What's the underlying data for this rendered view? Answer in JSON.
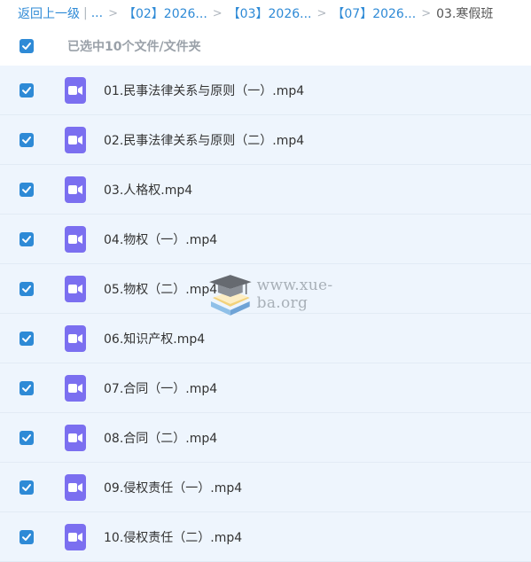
{
  "breadcrumb": {
    "back_label": "返回上一级",
    "pipe": "|",
    "ellipsis": "...",
    "separator": ">",
    "items": [
      "【02】2026...",
      "【03】2026...",
      "【07】2026..."
    ],
    "current": "03.寒假班"
  },
  "select_all": {
    "label": "已选中10个文件/文件夹",
    "checked": true
  },
  "files": [
    {
      "name": "01.民事法律关系与原则（一）.mp4",
      "checked": true
    },
    {
      "name": "02.民事法律关系与原则（二）.mp4",
      "checked": true
    },
    {
      "name": "03.人格权.mp4",
      "checked": true
    },
    {
      "name": "04.物权（一）.mp4",
      "checked": true
    },
    {
      "name": "05.物权（二）.mp4",
      "checked": true
    },
    {
      "name": "06.知识产权.mp4",
      "checked": true
    },
    {
      "name": "07.合同（一）.mp4",
      "checked": true
    },
    {
      "name": "08.合同（二）.mp4",
      "checked": true
    },
    {
      "name": "09.侵权责任（一）.mp4",
      "checked": true
    },
    {
      "name": "10.侵权责任（二）.mp4",
      "checked": true
    }
  ],
  "file_icon": "video-file-icon",
  "watermark": {
    "text": "www.xue-ba.org",
    "logo": "graduation-cap-books-logo"
  },
  "colors": {
    "accent": "#2e8ad6",
    "video_icon": "#7b6ff0",
    "row_bg": "#eef5fd"
  }
}
